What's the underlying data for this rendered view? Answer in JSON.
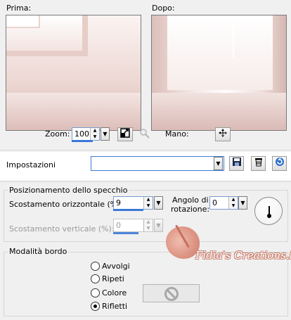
{
  "preview": {
    "before_label": "Prima:",
    "after_label": "Dopo:"
  },
  "zoom": {
    "label": "Zoom:",
    "value": "100",
    "pan_label": "Mano:"
  },
  "settings": {
    "label": "Impostazioni",
    "value": ""
  },
  "mirror": {
    "title": "Posizionamento dello specchio",
    "h_offset_label": "Scostamento orizzontale (%):",
    "h_offset_value": "9",
    "v_offset_label": "Scostamento verticale (%):",
    "v_offset_value": "0",
    "angle_label_1": "Angolo di",
    "angle_label_2": "rotazione:",
    "angle_value": "0"
  },
  "edge": {
    "title": "Modalità bordo",
    "options": [
      "Avvolgi",
      "Ripeti",
      "Colore",
      "Rifletti"
    ],
    "selected": "Rifletti"
  },
  "watermark": {
    "text": "Fidia's Creations.it"
  },
  "icons": {
    "zoom_fit": "fit-window-icon",
    "zoom_dim": "zoom-tool-icon",
    "pan": "move-arrows-icon",
    "save": "floppy-save-icon",
    "delete": "trash-icon",
    "reset": "reset-icon",
    "no_color": "no-color-icon"
  }
}
